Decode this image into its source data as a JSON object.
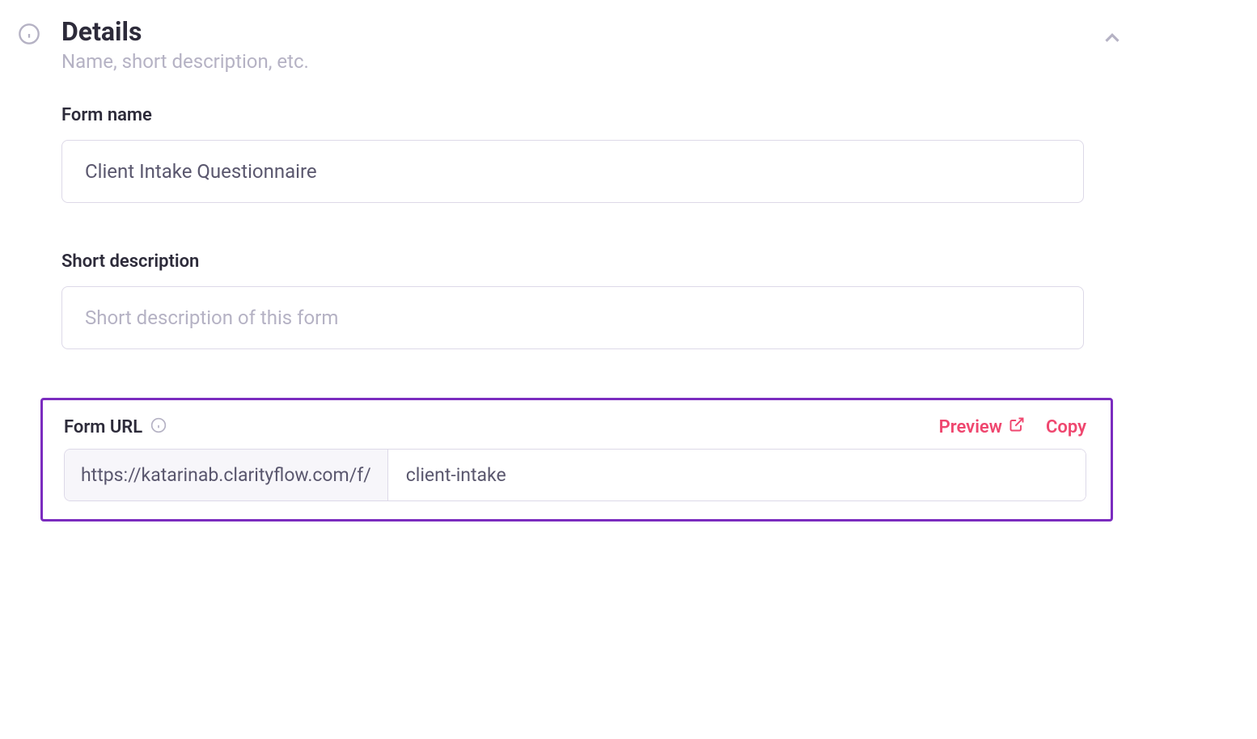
{
  "details": {
    "title": "Details",
    "subtitle": "Name, short description, etc."
  },
  "form_name": {
    "label": "Form name",
    "value": "Client Intake Questionnaire"
  },
  "short_description": {
    "label": "Short description",
    "placeholder": "Short description of this form",
    "value": ""
  },
  "form_url": {
    "label": "Form URL",
    "prefix": "https://katarinab.clarityflow.com/f/",
    "slug": "client-intake",
    "actions": {
      "preview": "Preview",
      "copy": "Copy"
    }
  }
}
